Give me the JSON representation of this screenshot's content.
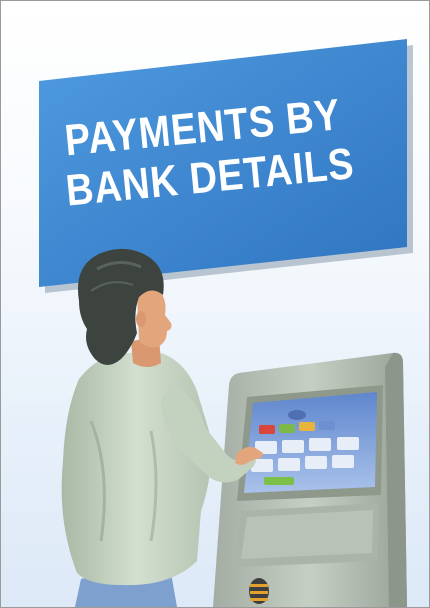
{
  "banner": {
    "line1": "PAYMENTS BY",
    "line2": "BANK DETAILS"
  },
  "colors": {
    "banner_blue": "#3a86d1",
    "banner_shadow": "#9fb0c0",
    "background_bottom": "#dde9f7",
    "kiosk_body": "#b9c3b8",
    "screen": "#7fa1d8",
    "shirt": "#c8d6c4",
    "hair": "#3d4440",
    "skin": "#e3a67c",
    "jeans": "#7ea0cf"
  },
  "screen_buttons": {
    "top_row_colors": [
      "#d9463c",
      "#7cb84a",
      "#e7b53c",
      "#6e8fd0"
    ]
  }
}
